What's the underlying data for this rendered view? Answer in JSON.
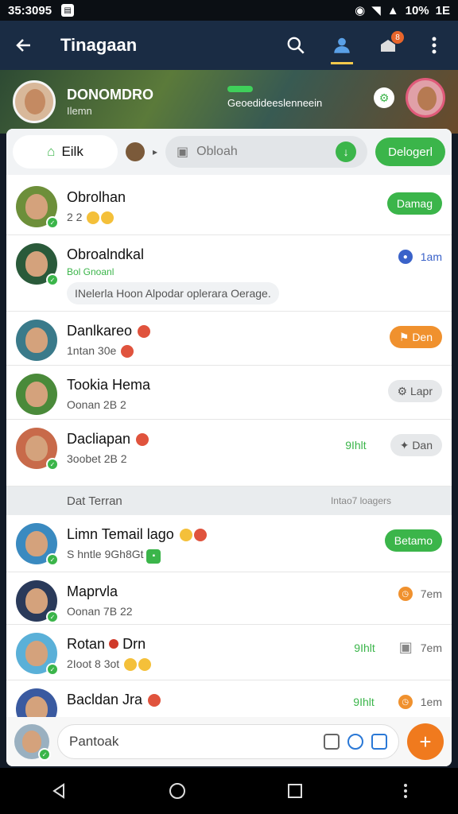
{
  "status": {
    "time": "35:3095",
    "battery": "10%",
    "extra": "1E"
  },
  "appbar": {
    "title": "Tinagaan",
    "badge": "8"
  },
  "hero": {
    "name": "DONOMDRO",
    "subtitle": "Ilemn",
    "mid_text": "Geoedideeslenneein"
  },
  "toolbar": {
    "home_label": "Eilk",
    "search_placeholder": "Obloah",
    "action_label": "Delogerl"
  },
  "rows": [
    {
      "name": "Obrolhan",
      "sub": "2 2",
      "right": "Damag"
    },
    {
      "name": "Obroalndkal",
      "sub": "Bol Gnoanl",
      "msg": "INelerla Hoon Alpodar oplerara Oerage.",
      "right": "1am"
    },
    {
      "name": "Danlkareo",
      "sub": "1ntan 30e",
      "right": "Den"
    },
    {
      "name": "Tookia Hema",
      "sub": "Oonan 2B 2",
      "right": "Lapr"
    },
    {
      "name": "Dacliapan",
      "sub": "3oobet 2B 2",
      "time": "9Ihlt",
      "right": "Dan"
    }
  ],
  "section": {
    "title": "Dat Terran",
    "right": "Intao7 loagers"
  },
  "rows2": [
    {
      "name": "Limn Temail lago",
      "sub": "S hntle 9Gh8Gt",
      "right": "Betamo"
    },
    {
      "name": "Maprvla",
      "sub": "Oonan 7B 22",
      "right": "7em"
    },
    {
      "name": "Rotan",
      "name2": "Drn",
      "sub": "2Ioot 8 3ot",
      "time": "9Ihlt",
      "right": "7em"
    },
    {
      "name": "Bacldan Jra",
      "sub": "",
      "time": "9Ihlt",
      "right": "1em"
    }
  ],
  "compose": {
    "placeholder": "Pantoak"
  },
  "colors": {
    "green": "#3bb54a",
    "orange": "#f07a1e",
    "appbar": "#1a2c44"
  }
}
